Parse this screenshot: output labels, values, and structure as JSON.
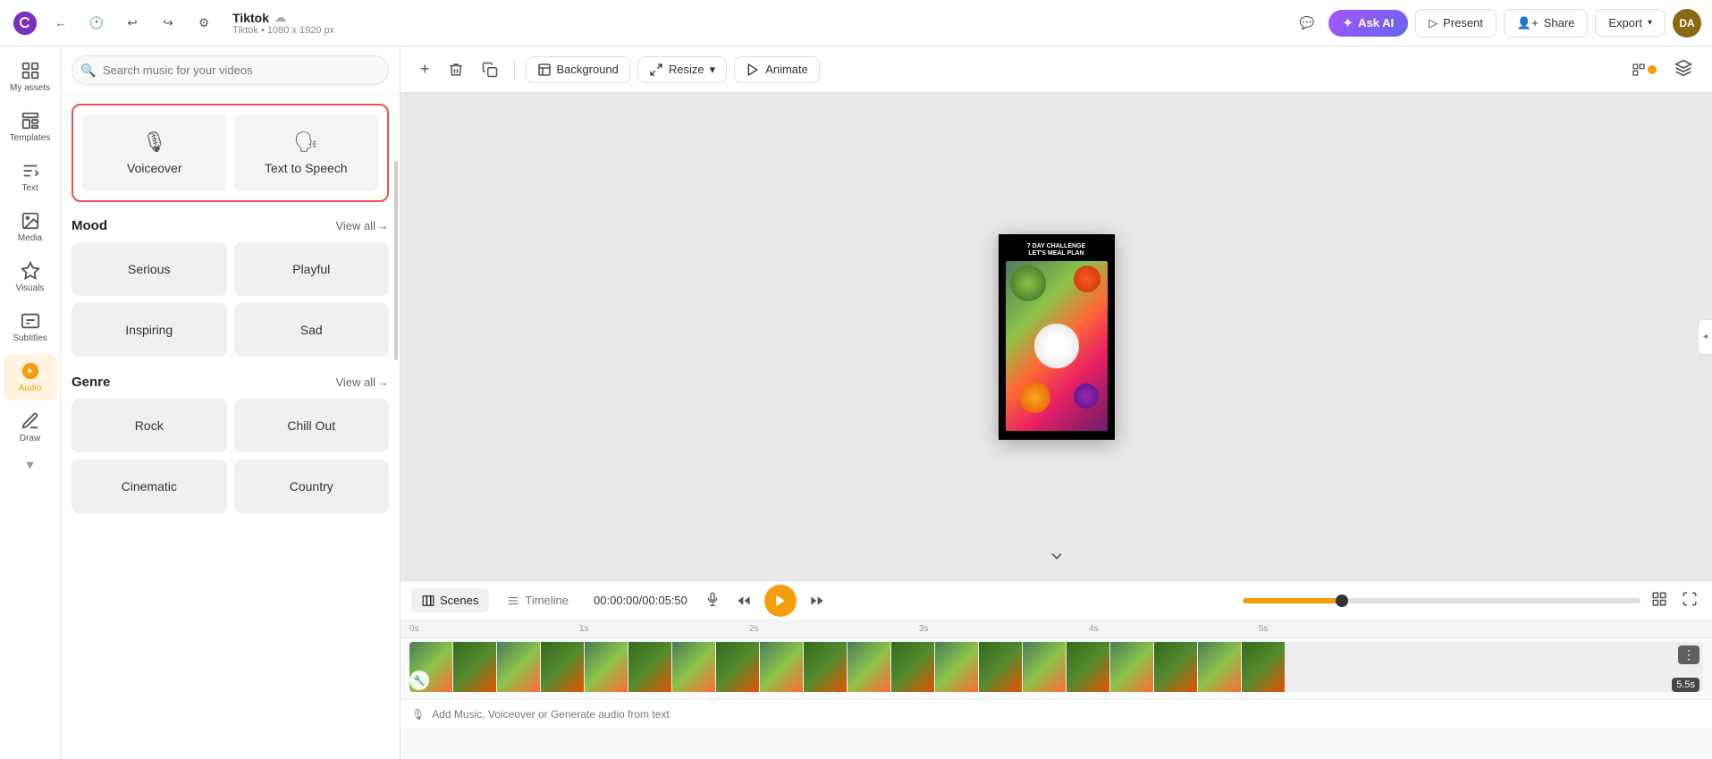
{
  "topbar": {
    "logo_label": "Canva",
    "back_label": "Back",
    "history_label": "History",
    "undo_label": "Undo",
    "redo_label": "Redo",
    "settings_label": "Settings",
    "title": "Tiktok",
    "cloud_sync": "synced",
    "dimensions": "Tiktok • 1080 x 1920 px",
    "comment_label": "Comment",
    "ask_ai_label": "Ask AI",
    "present_label": "Present",
    "share_label": "Share",
    "export_label": "Export",
    "avatar_initials": "DA"
  },
  "sidebar": {
    "items": [
      {
        "id": "my-assets",
        "label": "My assets",
        "icon": "grid"
      },
      {
        "id": "templates",
        "label": "Templates",
        "icon": "template"
      },
      {
        "id": "text",
        "label": "Text",
        "icon": "text"
      },
      {
        "id": "media",
        "label": "Media",
        "icon": "image"
      },
      {
        "id": "visuals",
        "label": "Visuals",
        "icon": "visuals"
      },
      {
        "id": "subtitles",
        "label": "Subtitles",
        "icon": "subtitles"
      },
      {
        "id": "audio",
        "label": "Audio",
        "icon": "music",
        "active": true
      },
      {
        "id": "draw",
        "label": "Draw",
        "icon": "draw"
      }
    ]
  },
  "panel": {
    "search_placeholder": "Search music for your videos",
    "audio_options": [
      {
        "id": "voiceover",
        "label": "Voiceover",
        "icon": "mic"
      },
      {
        "id": "text-to-speech",
        "label": "Text to Speech",
        "icon": "tts"
      }
    ],
    "mood_section": {
      "title": "Mood",
      "view_all": "View all",
      "items": [
        {
          "id": "serious",
          "label": "Serious"
        },
        {
          "id": "playful",
          "label": "Playful"
        },
        {
          "id": "inspiring",
          "label": "Inspiring"
        },
        {
          "id": "sad",
          "label": "Sad"
        }
      ]
    },
    "genre_section": {
      "title": "Genre",
      "view_all": "View all",
      "items": [
        {
          "id": "rock",
          "label": "Rock"
        },
        {
          "id": "chill-out",
          "label": "Chill Out"
        },
        {
          "id": "cinematic",
          "label": "Cinematic"
        },
        {
          "id": "country",
          "label": "Country"
        }
      ]
    }
  },
  "canvas_toolbar": {
    "add_label": "+",
    "delete_label": "🗑",
    "copy_label": "⧉",
    "background_label": "Background",
    "resize_label": "Resize",
    "animate_label": "Animate"
  },
  "canvas": {
    "challenge_line1": "7 DAY CHALLENGE",
    "challenge_line2": "LET'S MEAL PLAN"
  },
  "timeline": {
    "scenes_tab": "Scenes",
    "timeline_tab": "Timeline",
    "timecode": "00:00:00",
    "total_time": "00:05:50",
    "duration_badge": "5.5s",
    "add_audio_label": "Add Music, Voiceover or Generate audio from text"
  }
}
